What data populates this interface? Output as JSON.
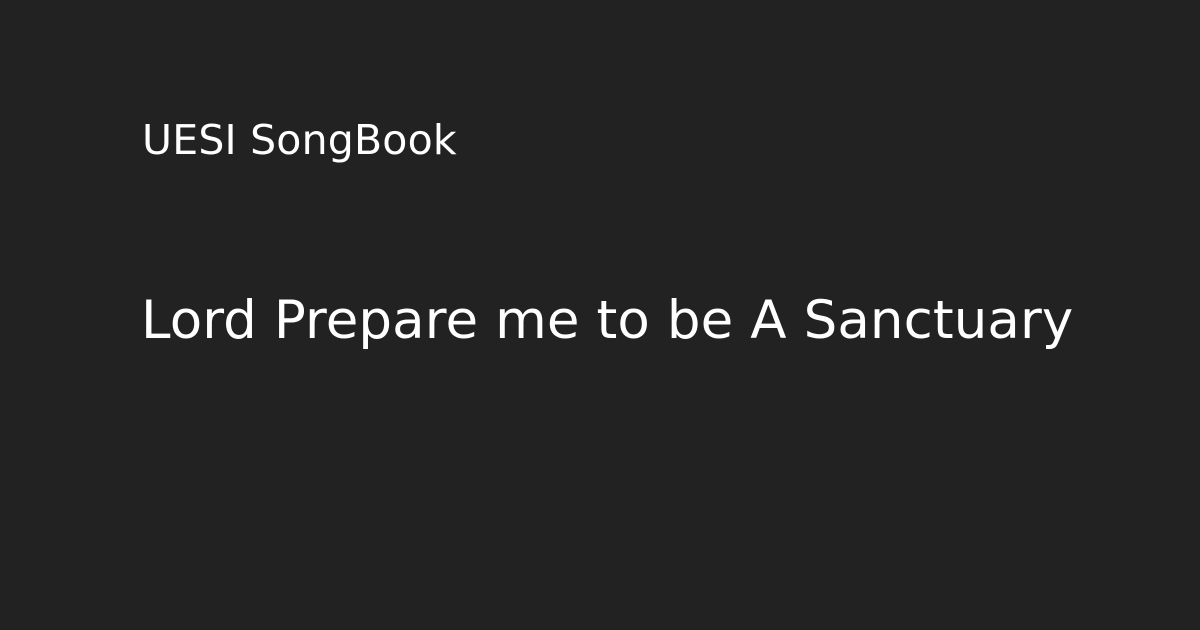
{
  "card": {
    "site_name": "UESI SongBook",
    "title": "Lord Prepare me to be A Sanctuary"
  },
  "colors": {
    "background": "#222222",
    "text": "#ffffff"
  }
}
